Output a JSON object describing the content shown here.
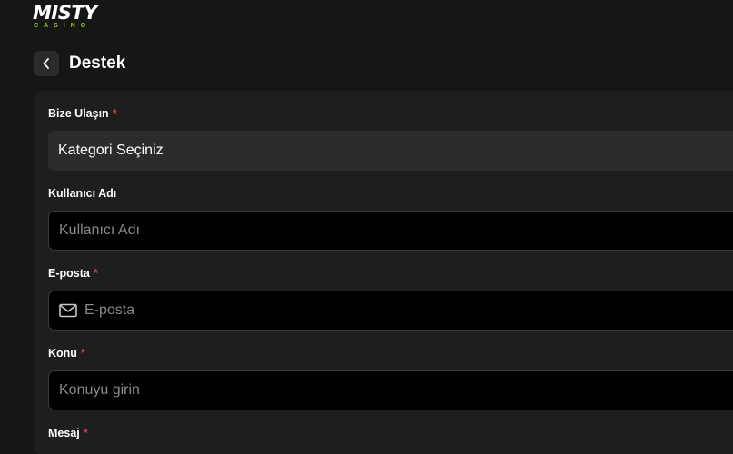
{
  "brand": {
    "name": "MISTY",
    "subtitle": "CASINO",
    "accent_color": "#b8ff2b"
  },
  "header": {
    "back_icon": "chevron-left-icon",
    "title": "Destek"
  },
  "form": {
    "contact": {
      "label": "Bize Ulaşın",
      "required_mark": "*",
      "selected": "Kategori Seçiniz"
    },
    "username": {
      "label": "Kullanıcı Adı",
      "placeholder": "Kullanıcı Adı"
    },
    "email": {
      "label": "E-posta",
      "required_mark": "*",
      "placeholder": "E-posta",
      "icon": "mail-icon"
    },
    "subject": {
      "label": "Konu",
      "required_mark": "*",
      "placeholder": "Konuyu girin"
    },
    "message": {
      "label": "Mesaj",
      "required_mark": "*"
    }
  },
  "colors": {
    "background": "#161616",
    "card": "#1e1e1e",
    "required": "#e0393e"
  }
}
